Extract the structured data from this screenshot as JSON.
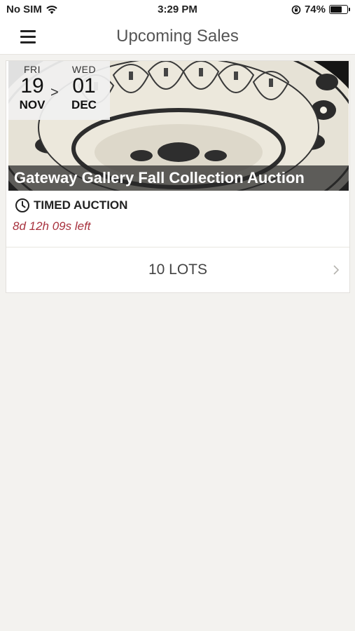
{
  "status_bar": {
    "carrier": "No SIM",
    "time": "3:29 PM",
    "battery_percent": "74%",
    "battery_level": 0.74,
    "icons": [
      "wifi-icon",
      "orientation-lock-icon",
      "battery-icon"
    ]
  },
  "nav": {
    "title": "Upcoming Sales",
    "menu_icon": "hamburger-menu-icon"
  },
  "sale": {
    "start": {
      "dow": "FRI",
      "day": "19",
      "month": "NOV"
    },
    "separator": ">",
    "end": {
      "dow": "WED",
      "day": "01",
      "month": "DEC"
    },
    "title": "Gateway Gallery Fall Collection Auction",
    "type": "TIMED AUCTION",
    "time_left": "8d 12h 09s left",
    "lots_label": "10 LOTS",
    "image_icon": "decorative-plate-image",
    "colors": {
      "time_left": "#a8323e"
    }
  }
}
